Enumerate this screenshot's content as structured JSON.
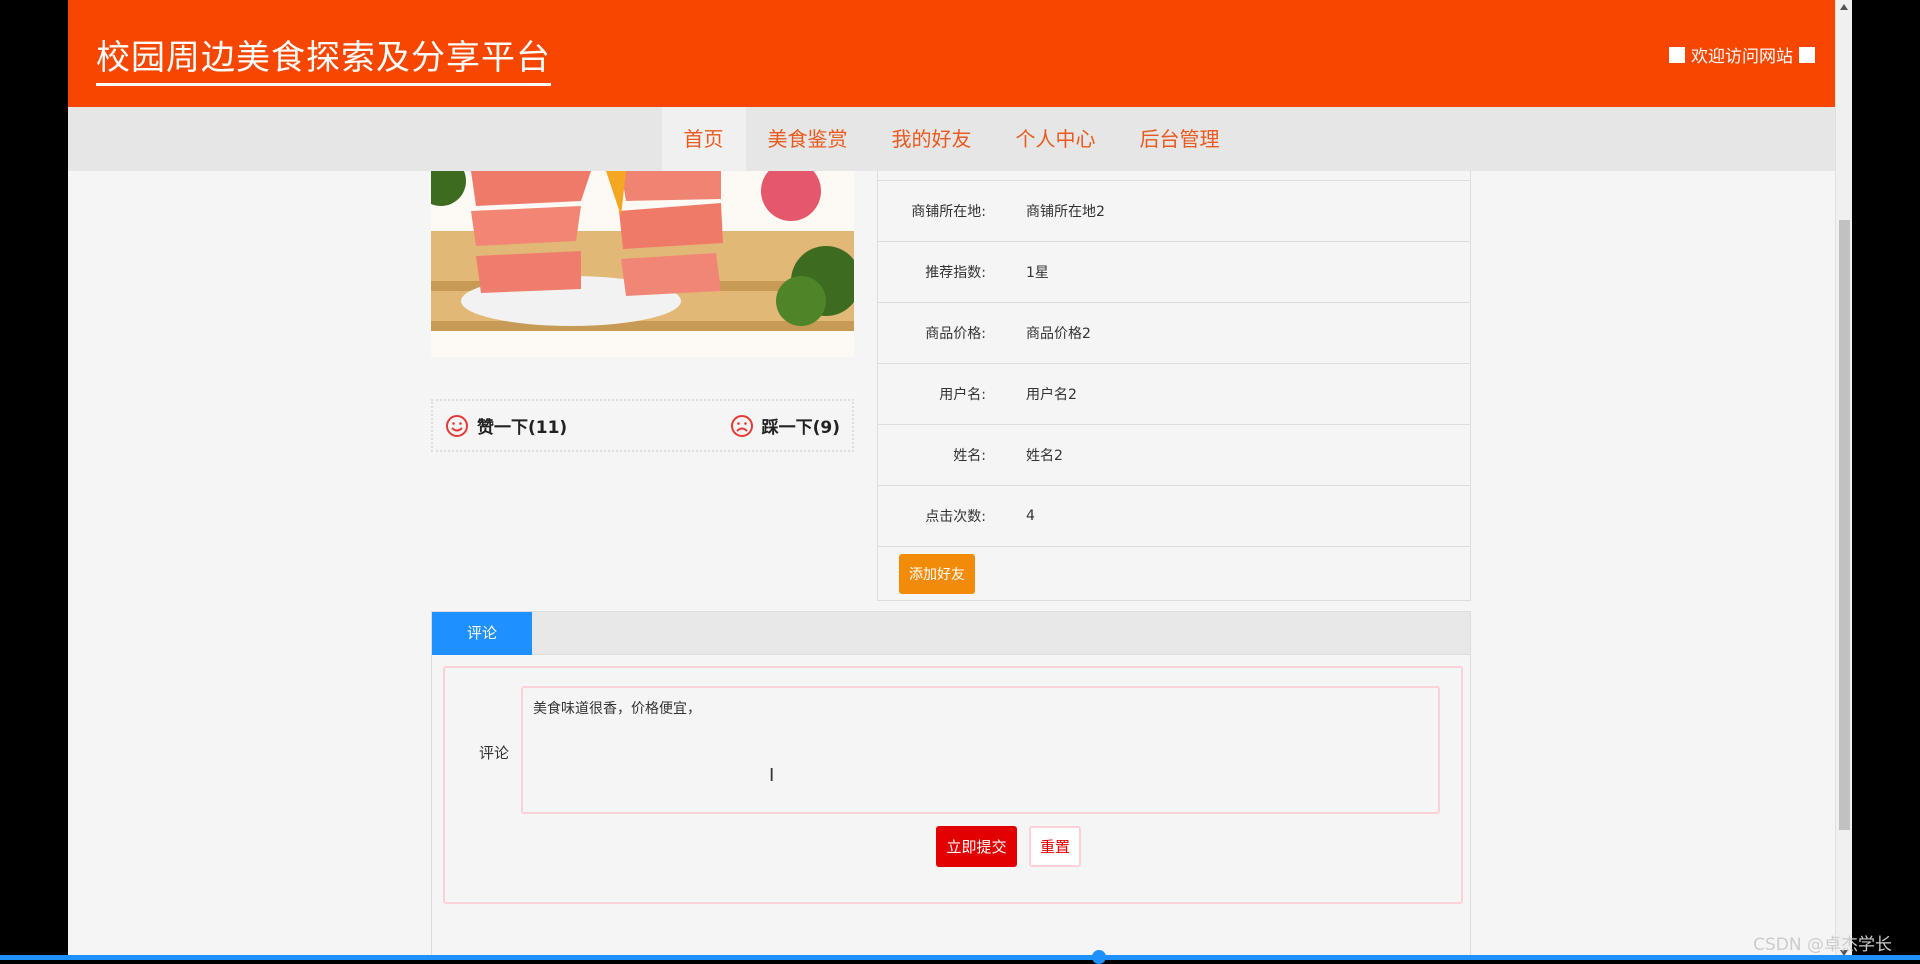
{
  "header": {
    "site_title": "校园周边美食探索及分享平台",
    "welcome": "欢迎访问网站"
  },
  "nav": {
    "items": [
      "首页",
      "美食鉴赏",
      "我的好友",
      "个人中心",
      "后台管理"
    ],
    "active": "首页"
  },
  "vote": {
    "like_label": "赞一下(11)",
    "dislike_label": "踩一下(9)"
  },
  "details": [
    {
      "key": "商铺所在地:",
      "value": "商铺所在地2"
    },
    {
      "key": "推荐指数:",
      "value": "1星"
    },
    {
      "key": "商品价格:",
      "value": "商品价格2"
    },
    {
      "key": "用户名:",
      "value": "用户名2"
    },
    {
      "key": "姓名:",
      "value": "姓名2"
    },
    {
      "key": "点击次数:",
      "value": "4"
    }
  ],
  "add_friend_label": "添加好友",
  "comment": {
    "tab_label": "评论",
    "form_label": "评论",
    "text": "美食味道很香，价格便宜，",
    "submit_label": "立即提交",
    "reset_label": "重置"
  },
  "watermark": "CSDN @卓杰学长",
  "colors": {
    "brand": "#f64600",
    "nav_text": "#e85a1e",
    "tab": "#1e90ff",
    "submit": "#e30000",
    "add_friend": "#f28b0a"
  }
}
